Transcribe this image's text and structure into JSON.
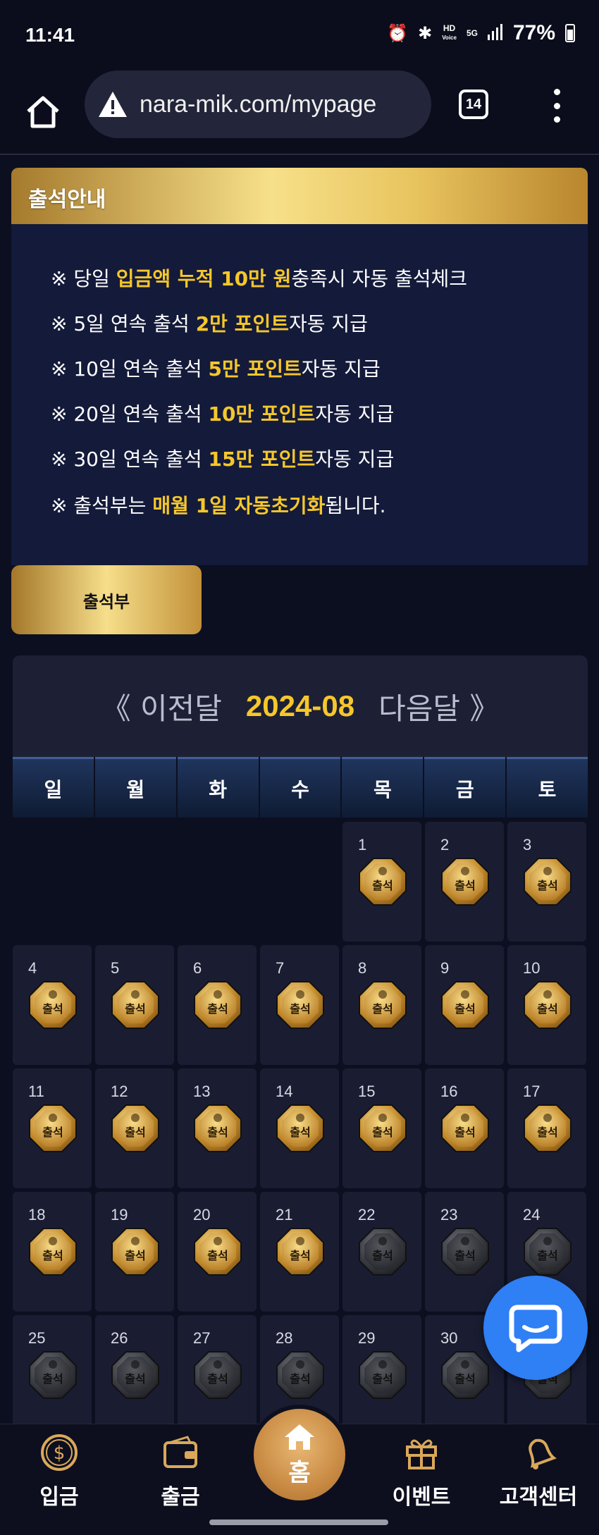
{
  "status": {
    "time": "11:41",
    "battery": "77%",
    "hd_label": "HD",
    "voice_label": "Voice",
    "net_label": "5G"
  },
  "browser": {
    "url": "nara-mik.com/mypage",
    "tab_count": "14"
  },
  "notice": {
    "title": "출석안내",
    "lines": [
      {
        "prefix": "※ 당일 ",
        "highlight": "입금액 누적 10만 원",
        "suffix": "충족시 자동 출석체크"
      },
      {
        "prefix": "※ 5일 연속 출석 ",
        "highlight": "2만 포인트",
        "suffix": "자동 지급"
      },
      {
        "prefix": "※ 10일 연속 출석 ",
        "highlight": "5만 포인트",
        "suffix": "자동 지급"
      },
      {
        "prefix": "※ 20일 연속 출석 ",
        "highlight": "10만 포인트",
        "suffix": "자동 지급"
      },
      {
        "prefix": "※ 30일 연속 출석 ",
        "highlight": "15만 포인트",
        "suffix": "자동 지급"
      },
      {
        "prefix": "※ 출석부는 ",
        "highlight": "매월 1일 자동초기화",
        "suffix": "됩니다."
      }
    ]
  },
  "attendance_button": "출석부",
  "calendar": {
    "prev_label": "《 이전달",
    "month": "2024-08",
    "next_label": "다음달 》",
    "weekdays": [
      "일",
      "월",
      "화",
      "수",
      "목",
      "금",
      "토"
    ],
    "stamp_label": "출석",
    "leading_blanks": 4,
    "days": [
      {
        "d": "1",
        "attended": true
      },
      {
        "d": "2",
        "attended": true
      },
      {
        "d": "3",
        "attended": true
      },
      {
        "d": "4",
        "attended": true
      },
      {
        "d": "5",
        "attended": true
      },
      {
        "d": "6",
        "attended": true
      },
      {
        "d": "7",
        "attended": true
      },
      {
        "d": "8",
        "attended": true
      },
      {
        "d": "9",
        "attended": true
      },
      {
        "d": "10",
        "attended": true
      },
      {
        "d": "11",
        "attended": true
      },
      {
        "d": "12",
        "attended": true
      },
      {
        "d": "13",
        "attended": true
      },
      {
        "d": "14",
        "attended": true
      },
      {
        "d": "15",
        "attended": true
      },
      {
        "d": "16",
        "attended": true
      },
      {
        "d": "17",
        "attended": true
      },
      {
        "d": "18",
        "attended": true
      },
      {
        "d": "19",
        "attended": true
      },
      {
        "d": "20",
        "attended": true
      },
      {
        "d": "21",
        "attended": true
      },
      {
        "d": "22",
        "attended": false
      },
      {
        "d": "23",
        "attended": false
      },
      {
        "d": "24",
        "attended": false
      },
      {
        "d": "25",
        "attended": false
      },
      {
        "d": "26",
        "attended": false
      },
      {
        "d": "27",
        "attended": false
      },
      {
        "d": "28",
        "attended": false
      },
      {
        "d": "29",
        "attended": false
      },
      {
        "d": "30",
        "attended": false
      },
      {
        "d": "31",
        "attended": false
      }
    ]
  },
  "bottom_nav": {
    "deposit": "입금",
    "withdraw": "출금",
    "home": "홈",
    "event": "이벤트",
    "support": "고객센터"
  },
  "colors": {
    "gold": "#f5c72b",
    "bg": "#0c0f20",
    "panel": "#141a3a",
    "chat": "#2f7ff5"
  }
}
